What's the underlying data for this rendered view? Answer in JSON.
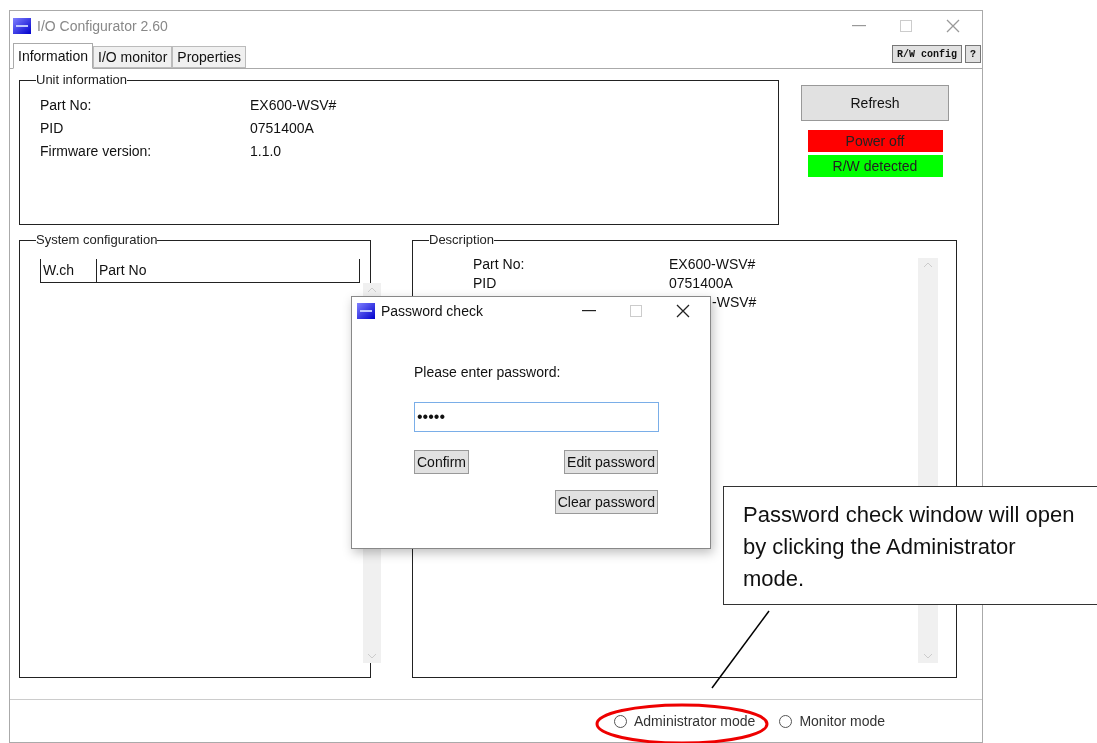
{
  "window": {
    "title": "I/O Configurator 2.60",
    "toolbar_buttons": [
      "R/W config",
      "?"
    ]
  },
  "tabs": [
    {
      "label": "Information",
      "selected": true
    },
    {
      "label": "I/O monitor",
      "selected": false
    },
    {
      "label": "Properties",
      "selected": false
    }
  ],
  "unit_information": {
    "title": "Unit information",
    "rows": [
      {
        "label": "Part No:",
        "value": "EX600-WSV#"
      },
      {
        "label": "PID",
        "value": "0751400A"
      },
      {
        "label": "Firmware version:",
        "value": "1.1.0"
      }
    ]
  },
  "refresh_button": "Refresh",
  "status_indicators": [
    {
      "label": "Power off",
      "color": "#ff0000"
    },
    {
      "label": "R/W detected",
      "color": "#00ff00"
    }
  ],
  "system_configuration": {
    "title": "System configuration",
    "columns": [
      "W.ch",
      "Part No"
    ]
  },
  "description": {
    "title": "Description",
    "rows": [
      {
        "kind": "full",
        "label": "Part No:",
        "value": "EX600-WSV#"
      },
      {
        "kind": "full",
        "label": "PID",
        "value": "0751400A"
      },
      {
        "kind": "partial",
        "value": "-WSV#"
      }
    ]
  },
  "modes": [
    {
      "label": "Administrator mode",
      "selected": false
    },
    {
      "label": "Monitor mode",
      "selected": false
    }
  ],
  "password_dialog": {
    "title": "Password check",
    "prompt": "Please enter password:",
    "password": "•••••",
    "buttons": [
      "Confirm",
      "Edit password",
      "Clear password"
    ]
  },
  "callout": {
    "text": "Password check window will open by clicking the Administrator mode."
  }
}
